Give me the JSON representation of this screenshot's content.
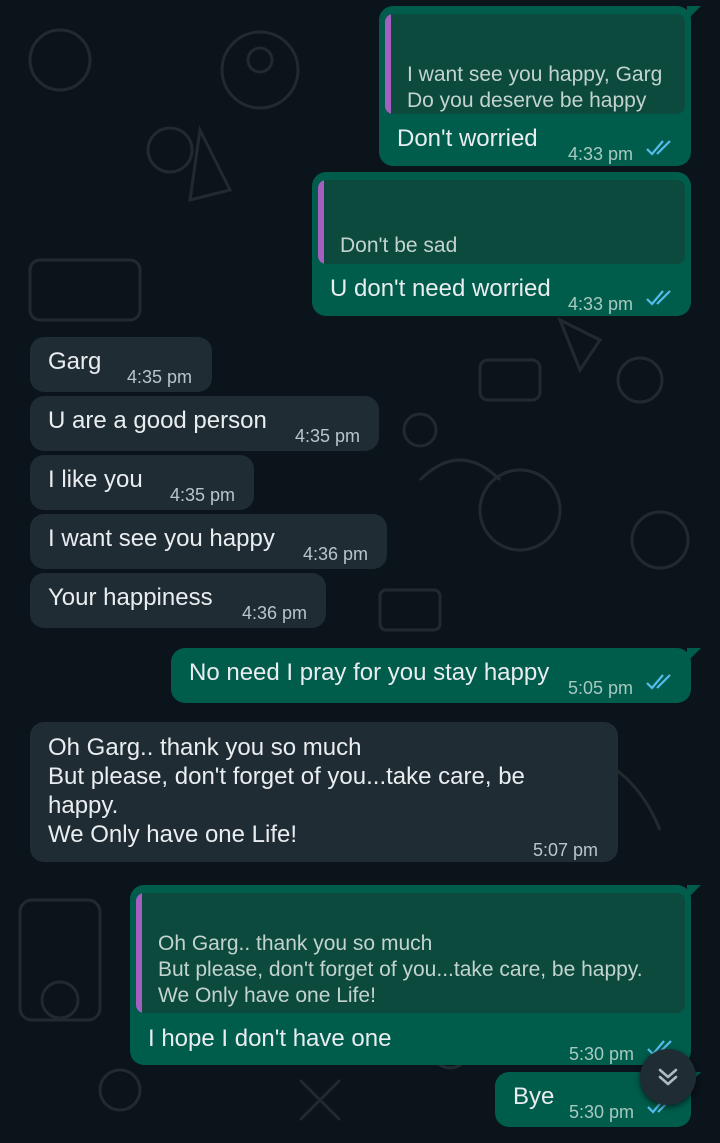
{
  "messages": [
    {
      "quote": "I want see you happy, Garg\nDo you deserve be happy",
      "text": "Don't worried",
      "time": "4:33 pm"
    },
    {
      "quote": "Don't be sad",
      "text": "U don't need worried",
      "time": "4:33 pm"
    },
    {
      "text": "Garg",
      "time": "4:35 pm"
    },
    {
      "text": "U are a good person",
      "time": "4:35 pm"
    },
    {
      "text": "I like you",
      "time": "4:35 pm"
    },
    {
      "text": "I want see you happy",
      "time": "4:36 pm"
    },
    {
      "text": "Your happiness",
      "time": "4:36 pm"
    },
    {
      "text": "No need I pray for you stay happy",
      "time": "5:05 pm"
    },
    {
      "text": "Oh Garg.. thank you so much\nBut please, don't forget of you...take care, be\nhappy.\nWe Only have one Life!",
      "time": "5:07 pm"
    },
    {
      "quote": "Oh Garg.. thank you so much\nBut please, don't forget of you...take care, be happy.\nWe Only have one Life!",
      "text": "I hope I don't have one",
      "time": "5:30 pm"
    },
    {
      "text": "Bye",
      "time": "5:30 pm"
    }
  ],
  "colors": {
    "background": "#0b141a",
    "incoming_bubble": "#202c33",
    "outgoing_bubble": "#005c4b",
    "quote_bar": "#a55fc0",
    "read_tick": "#53bdeb"
  },
  "icons": {
    "read_receipt": "double-check-icon",
    "scroll_down": "double-chevron-down-icon"
  }
}
